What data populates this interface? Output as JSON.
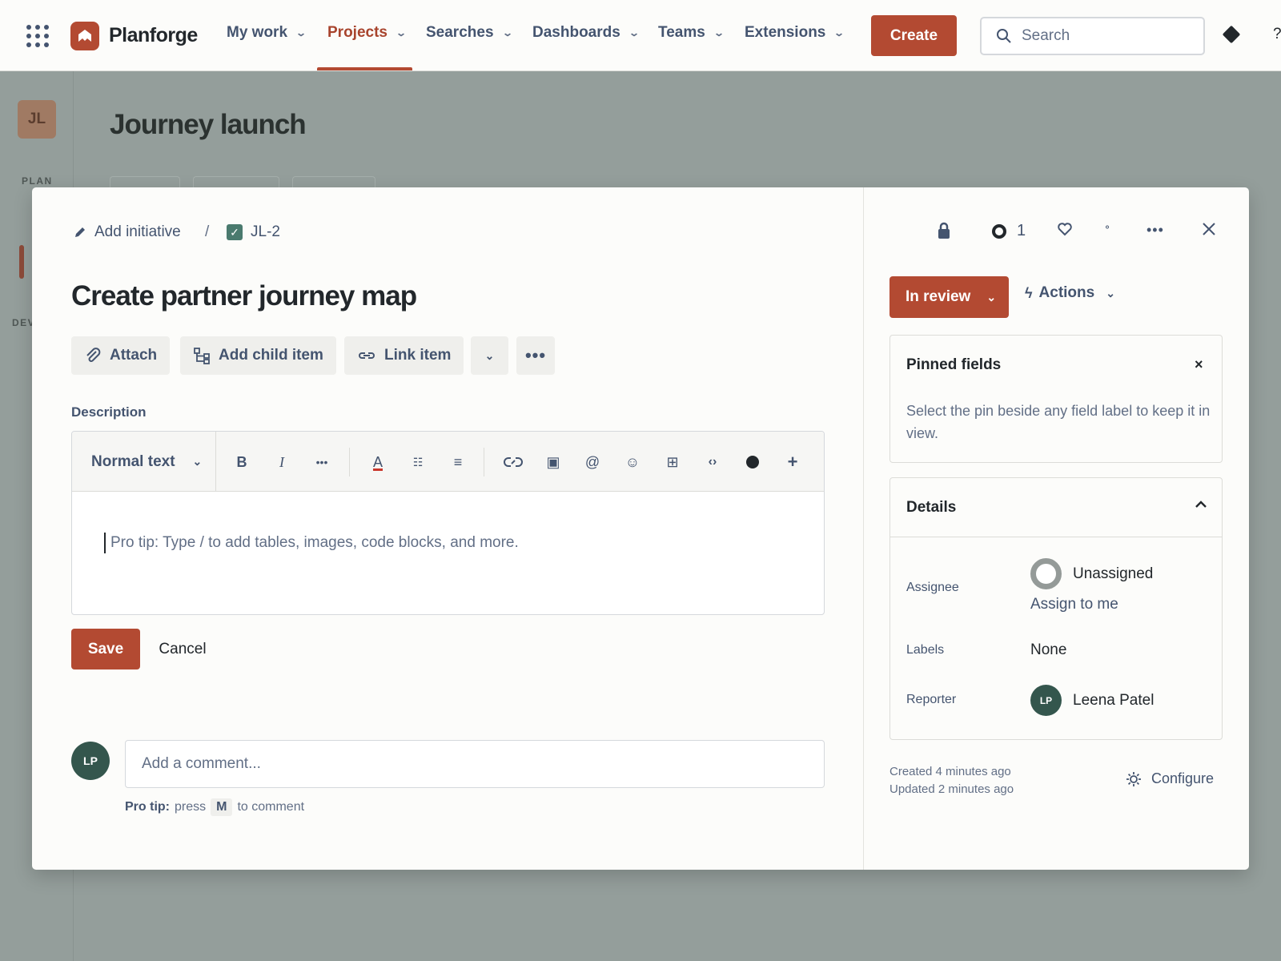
{
  "nav": {
    "brand": "Planforge",
    "items": [
      {
        "label": "My work"
      },
      {
        "label": "Projects"
      },
      {
        "label": "Searches"
      },
      {
        "label": "Dashboards"
      },
      {
        "label": "Teams"
      },
      {
        "label": "Extensions"
      }
    ],
    "create_label": "Create",
    "search_placeholder": "Search",
    "help_label": "?"
  },
  "background": {
    "project_initials": "JL",
    "plan_label": "PLAN",
    "dev_label": "DEV",
    "project_title": "Journey launch"
  },
  "modal": {
    "breadcrumb": {
      "add_initiative": "Add initiative",
      "separator": "/",
      "issue_key": "JL-2"
    },
    "title": "Create partner journey map",
    "toolbar": {
      "attach": "Attach",
      "add_child": "Add child item",
      "link_item": "Link item"
    },
    "description_label": "Description",
    "editor": {
      "text_style": "Normal text",
      "placeholder": "Pro tip: Type / to add tables, images, code blocks, and more."
    },
    "save_label": "Save",
    "cancel_label": "Cancel",
    "comment": {
      "avatar_initials": "LP",
      "placeholder": "Add a comment...",
      "protip_bold": "Pro tip:",
      "protip_press": "press",
      "protip_key": "M",
      "protip_after": "to comment"
    }
  },
  "panel": {
    "watch_count": "1",
    "status_label": "In review",
    "actions_label": "Actions",
    "pinned": {
      "title": "Pinned fields",
      "body": "Select the pin beside any field label to keep it in view."
    },
    "details": {
      "title": "Details",
      "assignee_label": "Assignee",
      "assignee_value": "Unassigned",
      "assign_to_me": "Assign to me",
      "labels_label": "Labels",
      "labels_value": "None",
      "reporter_label": "Reporter",
      "reporter_initials": "LP",
      "reporter_name": "Leena Patel"
    },
    "created": "Created 4 minutes ago",
    "updated": "Updated 2 minutes ago",
    "configure_label": "Configure"
  },
  "colors": {
    "brand": "#b34a32",
    "avatar": "#34564d"
  }
}
